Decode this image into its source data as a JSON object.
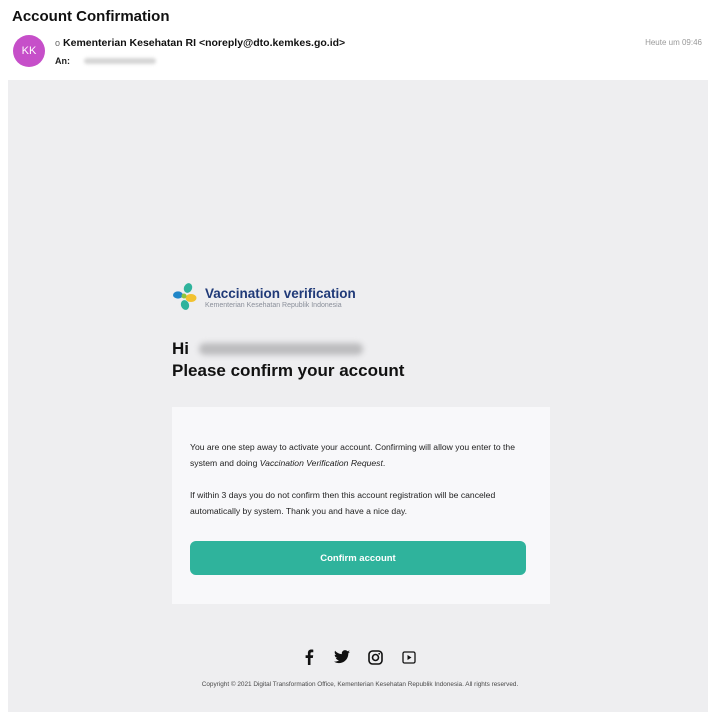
{
  "email": {
    "subject": "Account Confirmation",
    "avatar_initials": "KK",
    "avatar_color": "#c64fc9",
    "sender_indicator": "o",
    "sender": "Kementerian Kesehatan RI <noreply@dto.kemkes.go.id>",
    "to_label": "An:",
    "time": "Heute um 09:46"
  },
  "body": {
    "brand_title": "Vaccination verification",
    "brand_subtitle": "Kementerian Kesehatan Republik Indonesia",
    "greeting": "Hi",
    "headline": "Please confirm your account",
    "paragraph1_before": "You are one step away to activate your account. Confirming will allow you enter to the system and doing ",
    "paragraph1_emphasis": "Vaccination Verification Request",
    "paragraph1_after": ".",
    "paragraph2": "If within 3 days you do not confirm then this account registration will be canceled automatically by system. Thank you and have a nice day.",
    "button_label": "Confirm account",
    "button_color": "#2fb39c",
    "social_icons": [
      "facebook-icon",
      "twitter-icon",
      "instagram-icon",
      "youtube-icon"
    ],
    "copyright": "Copyright © 2021 Digital Transformation Office, Kementerian Kesehatan Republik Indonesia. All rights reserved."
  }
}
